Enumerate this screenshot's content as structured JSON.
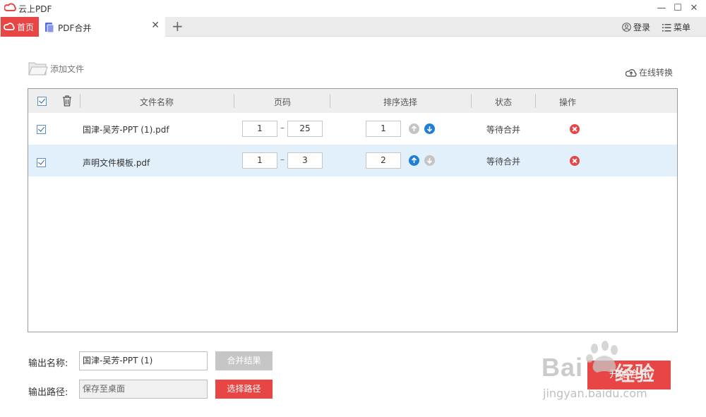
{
  "window": {
    "title": "云上PDF",
    "minimize": "—",
    "maximize": "☐",
    "close": "✕"
  },
  "tabs": {
    "home_label": "首页",
    "pdf_label": "PDF合并",
    "close": "✕",
    "add": "+"
  },
  "header": {
    "login": "登录",
    "menu": "菜单"
  },
  "toolbar": {
    "add_file": "添加文件",
    "online_convert": "在线转换"
  },
  "table": {
    "columns": [
      "文件名称",
      "页码",
      "排序选择",
      "状态",
      "操作"
    ],
    "rows": [
      {
        "checked": true,
        "filename": "国津-吴芳-PPT (1).pdf",
        "page_from": "1",
        "page_to": "25",
        "order": "1",
        "up_enabled": false,
        "down_enabled": true,
        "status": "等待合并",
        "selected": false
      },
      {
        "checked": true,
        "filename": "声明文件模板.pdf",
        "page_from": "1",
        "page_to": "3",
        "order": "2",
        "up_enabled": true,
        "down_enabled": false,
        "status": "等待合并",
        "selected": true
      }
    ],
    "page_sep": "–"
  },
  "output": {
    "name_label": "输出名称:",
    "name_value": "国津-吴芳-PPT (1)",
    "merge_result": "合并结果",
    "path_label": "输出路径:",
    "path_value": "保存至桌面",
    "choose_path": "选择路径",
    "start_merge": "开始合并"
  },
  "watermark": {
    "brand": "Bai",
    "brand2": "经验",
    "url": "jingyan.baidu.com"
  },
  "colors": {
    "accent": "#e84545",
    "selected_row": "#e1f0fb",
    "arrow_active": "#1e7fd6",
    "arrow_disabled": "#c4c4c4"
  }
}
